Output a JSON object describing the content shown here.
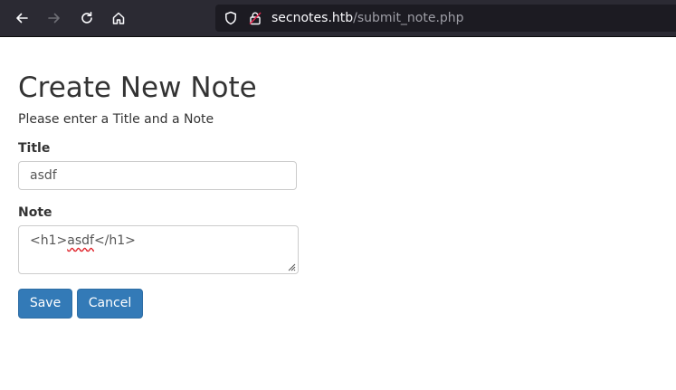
{
  "browser": {
    "url_host": "secnotes.htb",
    "url_path": "/submit_note.php",
    "icons": [
      "back-arrow-icon",
      "forward-arrow-icon",
      "reload-icon",
      "home-icon",
      "shield-icon",
      "insecure-lock-icon"
    ]
  },
  "page": {
    "title": "Create New Note",
    "instructions": "Please enter a Title and a Note"
  },
  "form": {
    "title_label": "Title",
    "title_value": "asdf",
    "note_label": "Note",
    "note_value_prefix": "<h1>",
    "note_value_misspelled": "asdf",
    "note_value_suffix": "</h1>",
    "save_label": "Save",
    "cancel_label": "Cancel"
  },
  "colors": {
    "primary_button": "#337ab7",
    "browser_toolbar": "#2b2a33",
    "url_field": "#1c1b22"
  }
}
